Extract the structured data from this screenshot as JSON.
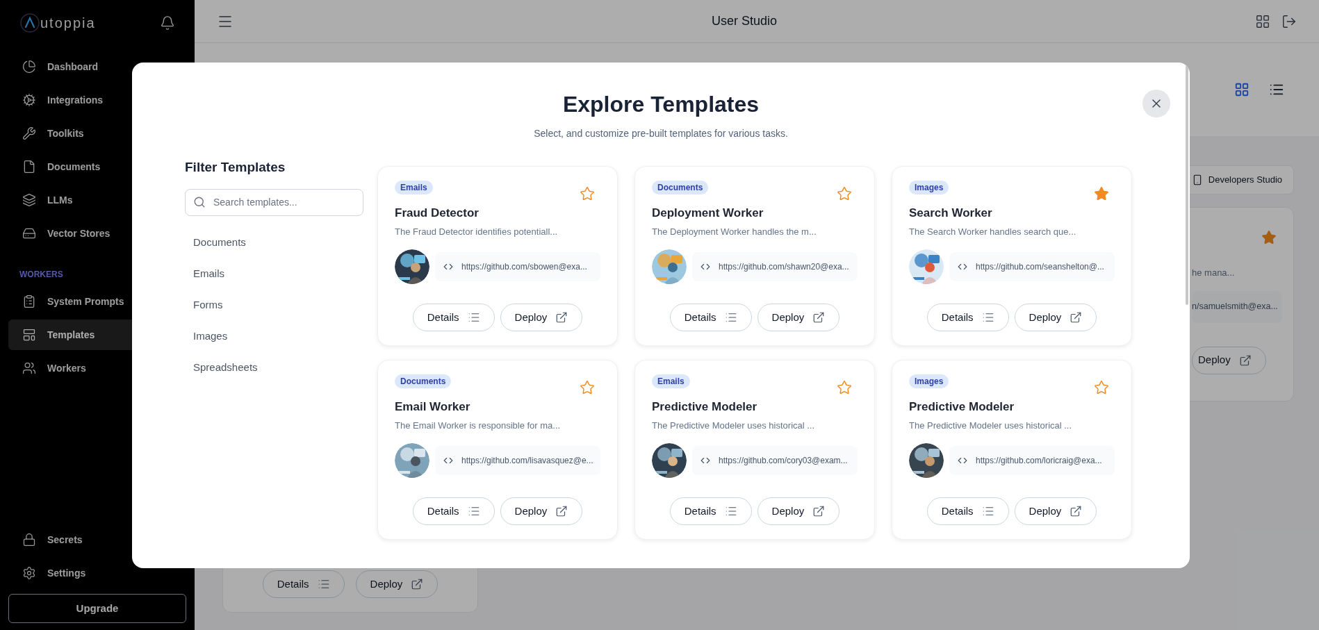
{
  "sidebar": {
    "brand": "utoppia",
    "nav": [
      {
        "label": "Dashboard",
        "selected": false
      },
      {
        "label": "Integrations",
        "selected": false
      },
      {
        "label": "Toolkits",
        "selected": false
      },
      {
        "label": "Documents",
        "selected": false
      },
      {
        "label": "LLMs",
        "selected": false
      },
      {
        "label": "Vector Stores",
        "selected": false
      }
    ],
    "section_label": "WORKERS",
    "worker_nav": [
      {
        "label": "System Prompts",
        "selected": false
      },
      {
        "label": "Templates",
        "selected": true
      },
      {
        "label": "Workers",
        "selected": false
      }
    ],
    "bottom_nav": [
      {
        "label": "Secrets",
        "selected": false
      },
      {
        "label": "Settings",
        "selected": false
      }
    ],
    "upgrade_button": "Upgrade"
  },
  "header": {
    "title": "User Studio"
  },
  "background": {
    "view_toggle": [
      {
        "kind": "grid",
        "selected": true
      },
      {
        "kind": "list",
        "selected": false
      }
    ],
    "developers_button": "Developers Studio",
    "partial_card": {
      "starred": true,
      "description": "he mana...",
      "url": "n/samuelsmith@exa...",
      "deploy_button": "Deploy"
    },
    "bottom_card": {
      "details_button": "Details",
      "deploy_button": "Deploy"
    }
  },
  "modal": {
    "title": "Explore Templates",
    "subtitle": "Select, and customize pre-built templates for various tasks.",
    "filter_title": "Filter Templates",
    "search_placeholder": "Search templates...",
    "categories": [
      "Documents",
      "Emails",
      "Forms",
      "Images",
      "Spreadsheets"
    ],
    "templates": [
      {
        "category": "Emails",
        "title": "Fraud Detector",
        "description": "The Fraud Detector identifies potentiall...",
        "url": "https://github.com/sbowen@exa...",
        "starred": false,
        "details_button": "Details",
        "deploy_button": "Deploy"
      },
      {
        "category": "Documents",
        "title": "Deployment Worker",
        "description": "The Deployment Worker handles the m...",
        "url": "https://github.com/shawn20@exa...",
        "starred": false,
        "details_button": "Details",
        "deploy_button": "Deploy"
      },
      {
        "category": "Images",
        "title": "Search Worker",
        "description": "The Search Worker handles search que...",
        "url": "https://github.com/seanshelton@...",
        "starred": true,
        "details_button": "Details",
        "deploy_button": "Deploy"
      },
      {
        "category": "Documents",
        "title": "Email Worker",
        "description": "The Email Worker is responsible for ma...",
        "url": "https://github.com/lisavasquez@e...",
        "starred": false,
        "details_button": "Details",
        "deploy_button": "Deploy"
      },
      {
        "category": "Emails",
        "title": "Predictive Modeler",
        "description": "The Predictive Modeler uses historical ...",
        "url": "https://github.com/cory03@exam...",
        "starred": false,
        "details_button": "Details",
        "deploy_button": "Deploy"
      },
      {
        "category": "Images",
        "title": "Predictive Modeler",
        "description": "The Predictive Modeler uses historical ...",
        "url": "https://github.com/loricraig@exa...",
        "starred": false,
        "details_button": "Details",
        "deploy_button": "Deploy"
      }
    ]
  }
}
